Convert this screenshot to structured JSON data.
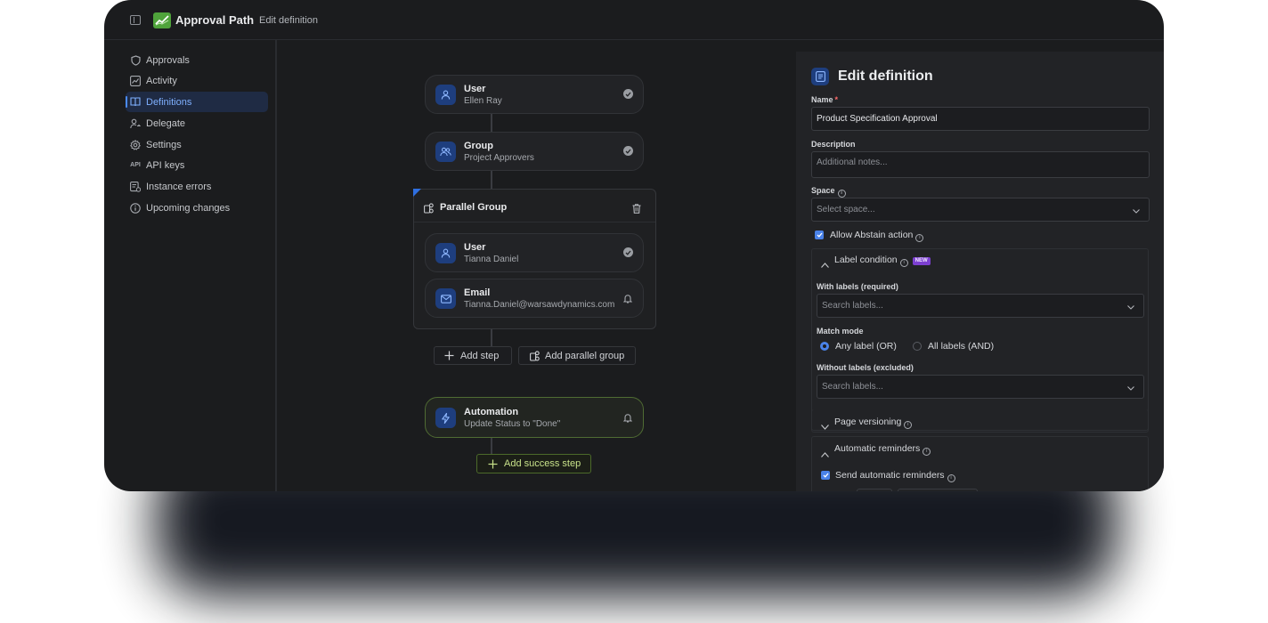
{
  "app": {
    "name": "Approval Path",
    "breadcrumb": "Edit definition"
  },
  "sidebar": {
    "items": [
      {
        "label": "Approvals",
        "icon": "shield-icon",
        "active": false
      },
      {
        "label": "Activity",
        "icon": "activity-chart-icon",
        "active": false
      },
      {
        "label": "Definitions",
        "icon": "book-icon",
        "active": true
      },
      {
        "label": "Delegate",
        "icon": "user-arrow-icon",
        "active": false
      },
      {
        "label": "Settings",
        "icon": "gear-icon",
        "active": false
      },
      {
        "label": "API keys",
        "icon": "api-icon",
        "active": false
      },
      {
        "label": "Instance errors",
        "icon": "error-log-icon",
        "active": false
      },
      {
        "label": "Upcoming changes",
        "icon": "info-icon",
        "active": false
      }
    ]
  },
  "flow": {
    "steps": [
      {
        "title": "User",
        "subtitle": "Ellen Ray"
      },
      {
        "title": "Group",
        "subtitle": "Project Approvers"
      }
    ],
    "parallel_group": {
      "title": "Parallel Group",
      "steps": [
        {
          "title": "User",
          "subtitle": "Tianna Daniel"
        },
        {
          "title": "Email",
          "subtitle": "Tianna.Daniel@warsawdynamics.com"
        }
      ]
    },
    "add_step_label": "Add step",
    "add_parallel_label": "Add parallel group",
    "automation": {
      "title": "Automation",
      "subtitle": "Update Status to \"Done\""
    },
    "add_success_label": "Add success step"
  },
  "panel": {
    "title": "Edit definition",
    "name_label": "Name",
    "name_value": "Product Specification Approval",
    "description_label": "Description",
    "description_placeholder": "Additional notes...",
    "space_label": "Space",
    "space_placeholder": "Select space...",
    "allow_abstain_label": "Allow Abstain action",
    "allow_abstain_checked": true,
    "label_condition": {
      "title": "Label condition",
      "badge": "NEW",
      "with_labels_label": "With labels (required)",
      "with_labels_placeholder": "Search labels...",
      "match_mode_label": "Match mode",
      "match_any": "Any label (OR)",
      "match_all": "All labels (AND)",
      "selected_mode": "any",
      "without_labels_label": "Without labels (excluded)",
      "without_labels_placeholder": "Search labels..."
    },
    "page_versioning_title": "Page versioning",
    "automatic_reminders": {
      "title": "Automatic reminders",
      "send_label": "Send automatic reminders",
      "send_checked": true
    }
  },
  "colors": {
    "accent": "#4a82e8",
    "success": "#c8e28a",
    "brand": "#4fa33b",
    "new_badge": "#7c3fd0"
  }
}
